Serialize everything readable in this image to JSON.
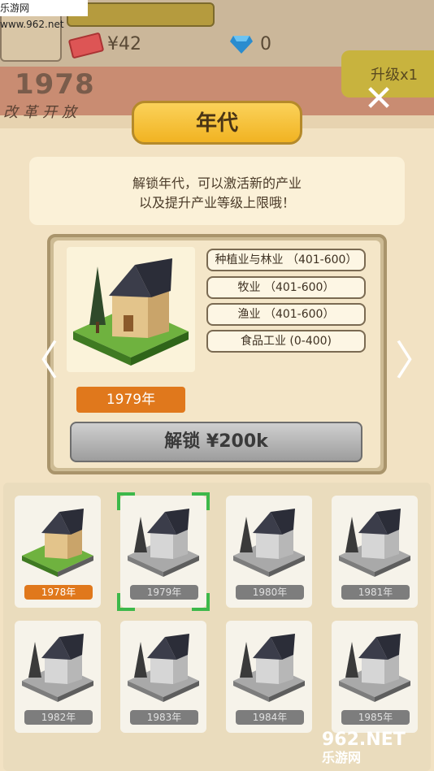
{
  "header": {
    "money": "¥42",
    "gems": "0",
    "year_big": "1978",
    "year_sub": "改革开放",
    "upgrade": "升级x1",
    "close_glyph": "✕"
  },
  "dialog": {
    "title": "年代",
    "info_line1": "解锁年代，可以激活新的产业",
    "info_line2": "以及提升产业等级上限哦！",
    "industries": [
      "种植业与林业 （401-600）",
      "牧业 （401-600）",
      "渔业 （401-600）",
      "食品工业 (0-400)"
    ],
    "selected_year": "1979年",
    "unlock_label": "解锁 ¥200k",
    "arrow_left": "〈",
    "arrow_right": "〉"
  },
  "eras": [
    "1978年",
    "1979年",
    "1980年",
    "1981年",
    "1982年",
    "1983年",
    "1984年",
    "1985年"
  ],
  "watermark": {
    "top_left": "乐游网 www.962.net",
    "bottom_right_1": "962.NET",
    "bottom_right_2": "乐游网"
  },
  "colors": {
    "accent_orange": "#e0781c",
    "locked_gray": "#7d7d7d",
    "selection_green": "#3db84a",
    "title_gold": "#f1b322"
  }
}
